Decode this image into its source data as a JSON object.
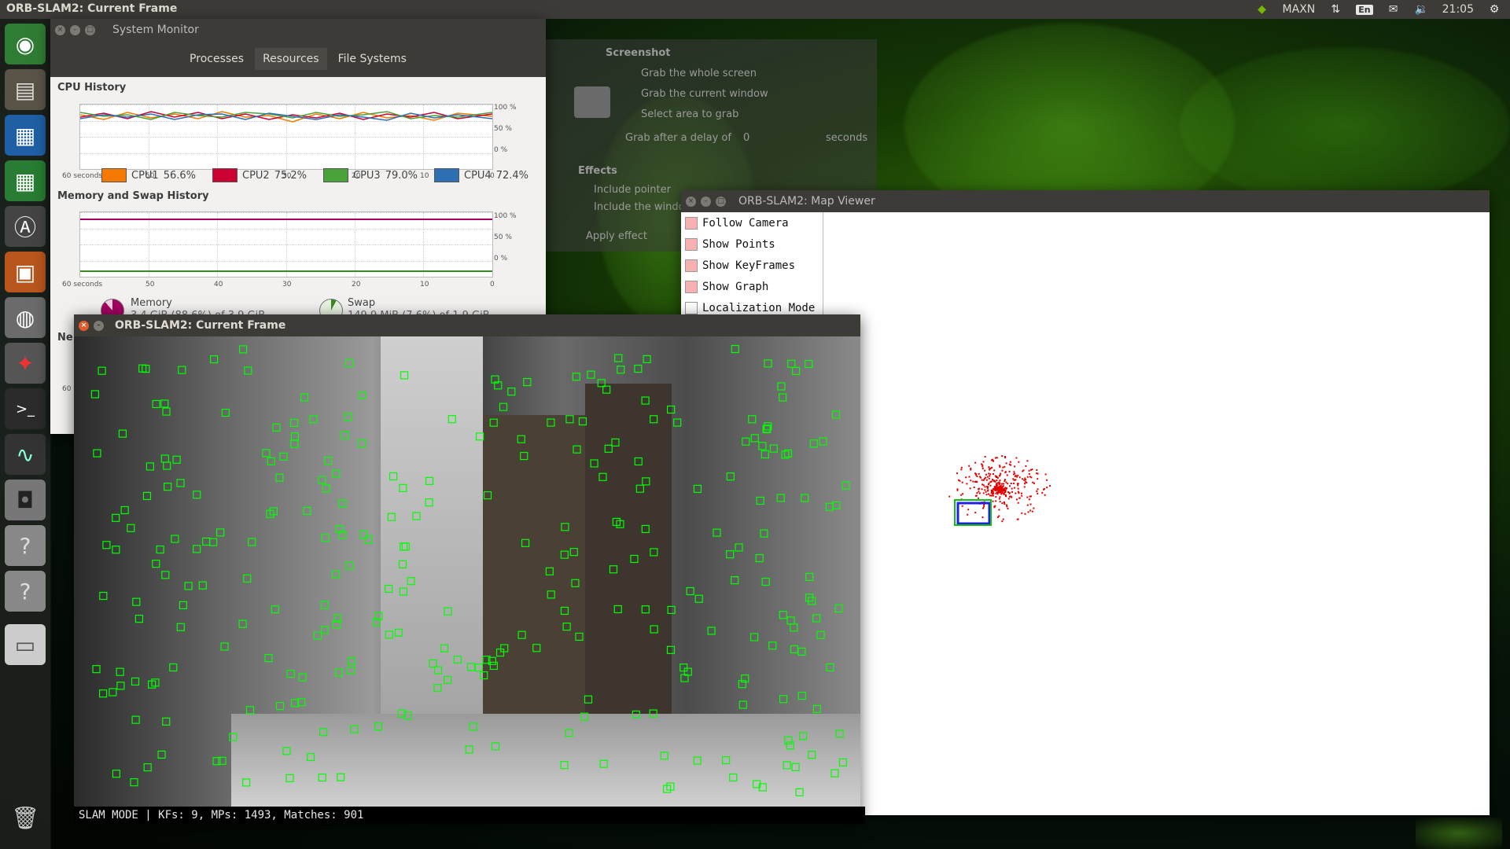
{
  "top_panel": {
    "title": "ORB-SLAM2: Current Frame",
    "power_mode": "MAXN",
    "lang": "En",
    "time": "21:05",
    "icons": [
      "nvidia-icon",
      "network-icon",
      "mail-icon",
      "volume-icon",
      "gear-icon"
    ]
  },
  "launcher": {
    "items": [
      "ubuntu-dash-icon",
      "files-icon",
      "writer-icon",
      "calc-icon",
      "software-updater-icon",
      "impress-icon",
      "software-center-icon",
      "system-settings-icon",
      "terminal-icon",
      "system-monitor-icon",
      "screenshot-icon",
      "unknown-app-icon",
      "unknown-app-icon",
      "drive-icon",
      "trash-icon"
    ]
  },
  "sysmon": {
    "title": "System Monitor",
    "tabs": [
      "Processes",
      "Resources",
      "File Systems"
    ],
    "active_tab": "Resources",
    "cpu_header": "CPU History",
    "mem_header": "Memory and Swap History",
    "net_header": "Ne",
    "x_ticks": [
      "60 seconds",
      "50",
      "40",
      "30",
      "20",
      "10",
      "0"
    ],
    "y_ticks": [
      "100 %",
      "50 %",
      "0 %"
    ],
    "cpus": [
      {
        "label": "CPU1",
        "value": "56.6%",
        "color": "#f57900"
      },
      {
        "label": "CPU2",
        "value": "75.2%",
        "color": "#cc0033"
      },
      {
        "label": "CPU3",
        "value": "79.0%",
        "color": "#4aa33a"
      },
      {
        "label": "CPU4",
        "value": "72.4%",
        "color": "#2d6fb3"
      }
    ],
    "memory": {
      "label": "Memory",
      "value": "3.4 GiB (88.6%) of 3.9 GiB",
      "color": "#a40062"
    },
    "swap": {
      "label": "Swap",
      "value": "149.9 MiB (7.6%) of 1.9 GiB",
      "color": "#3a8a24"
    },
    "net_tick": "60"
  },
  "screenshot_dialog": {
    "title": "Screenshot",
    "options": [
      "Grab the whole screen",
      "Grab the current window",
      "Select area to grab"
    ],
    "delay_label": "Grab after a delay of",
    "delay_value": "0",
    "delay_unit": "seconds",
    "effects": "Effects",
    "effect_items": [
      "Include pointer",
      "Include the window border"
    ],
    "apply": "Apply effect"
  },
  "map_viewer": {
    "title": "ORB-SLAM2: Map Viewer",
    "menu": [
      {
        "label": "Follow Camera",
        "checked": true
      },
      {
        "label": "Show Points",
        "checked": true
      },
      {
        "label": "Show KeyFrames",
        "checked": true
      },
      {
        "label": "Show Graph",
        "checked": true
      },
      {
        "label": "Localization Mode",
        "checked": false
      }
    ]
  },
  "current_frame": {
    "title": "ORB-SLAM2: Current Frame",
    "status": "SLAM MODE |  KFs: 9, MPs: 1493, Matches: 901"
  }
}
